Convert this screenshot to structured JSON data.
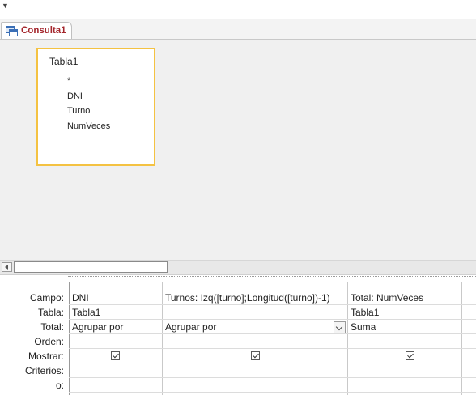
{
  "document_tab": {
    "label": "Consulta1",
    "icon": "query-icon"
  },
  "table_box": {
    "title": "Tabla1",
    "fields": [
      "*",
      "DNI",
      "Turno",
      "NumVeces"
    ]
  },
  "grid": {
    "row_labels": [
      "Campo:",
      "Tabla:",
      "Total:",
      "Orden:",
      "Mostrar:",
      "Criterios:",
      "o:"
    ],
    "columns": [
      {
        "campo": "DNI",
        "tabla": "Tabla1",
        "total": "Agrupar por",
        "orden": "",
        "mostrar": true,
        "criterios": "",
        "o": ""
      },
      {
        "campo": "Turnos: Izq([turno];Longitud([turno])-1)",
        "tabla": "",
        "total": "Agrupar por",
        "orden": "",
        "mostrar": true,
        "criterios": "",
        "o": ""
      },
      {
        "campo": "Total: NumVeces",
        "tabla": "Tabla1",
        "total": "Suma",
        "orden": "",
        "mostrar": true,
        "criterios": "",
        "o": ""
      },
      {
        "campo": "",
        "tabla": "",
        "total": "",
        "orden": "",
        "mostrar": false,
        "criterios": "",
        "o": ""
      }
    ]
  },
  "colors": {
    "accent": "#a4262c",
    "selection_border": "#f4c242",
    "designer_bg": "#f0f0f0"
  }
}
